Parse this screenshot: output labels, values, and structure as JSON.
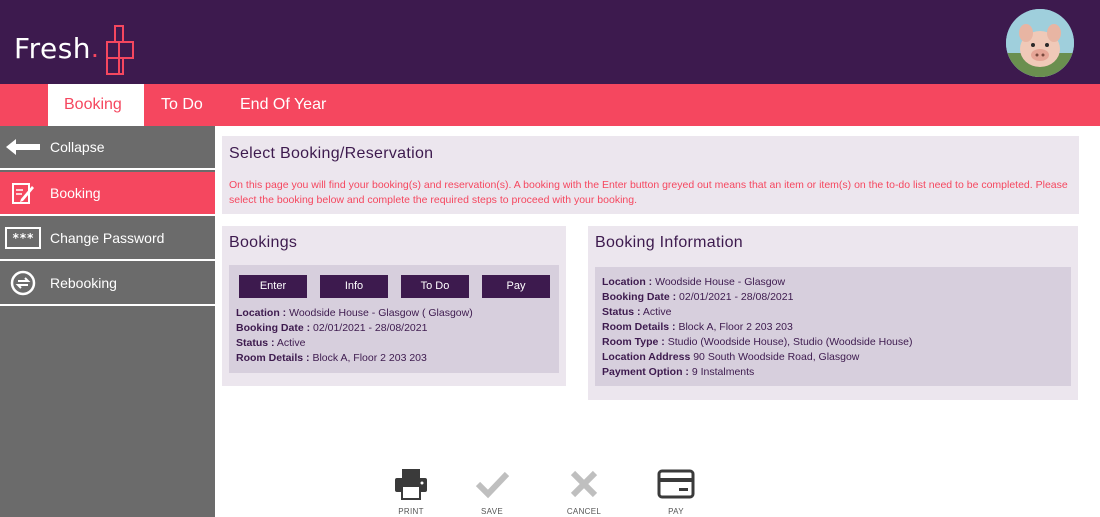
{
  "brand": {
    "name": "Fresh",
    "dot": ".",
    "accent": "#f5475f",
    "primary": "#3d1a4e"
  },
  "tabs": [
    {
      "label": "Booking",
      "active": true
    },
    {
      "label": "To Do",
      "active": false
    },
    {
      "label": "End Of Year",
      "active": false
    }
  ],
  "sidebar": {
    "items": [
      {
        "label": "Collapse",
        "icon": "arrow-left-icon",
        "active": false
      },
      {
        "label": "Booking",
        "icon": "edit-icon",
        "active": true
      },
      {
        "label": "Change Password",
        "icon": "password-icon",
        "active": false
      },
      {
        "label": "Rebooking",
        "icon": "rebooking-icon",
        "active": false
      }
    ]
  },
  "select_panel": {
    "title": "Select Booking/Reservation",
    "description": "On this page you will find your booking(s) and reservation(s). A booking with the Enter button greyed out means that an item or item(s) on the to-do list need to be completed. Please select the booking below and complete the required steps to proceed with your booking."
  },
  "bookings": {
    "title": "Bookings",
    "buttons": [
      "Enter",
      "Info",
      "To Do",
      "Pay"
    ],
    "details": [
      {
        "label": "Location :",
        "value": "Woodside House - Glasgow ( Glasgow)"
      },
      {
        "label": "Booking Date :",
        "value": "02/01/2021 - 28/08/2021"
      },
      {
        "label": "Status :",
        "value": "Active"
      },
      {
        "label": "Room Details :",
        "value": "Block A, Floor 2 203 203"
      }
    ]
  },
  "booking_info": {
    "title": "Booking Information",
    "details": [
      {
        "label": "Location :",
        "value": "Woodside House - Glasgow"
      },
      {
        "label": "Booking Date :",
        "value": "02/01/2021 - 28/08/2021"
      },
      {
        "label": "Status :",
        "value": "Active"
      },
      {
        "label": "Room Details :",
        "value": "Block A, Floor 2 203 203"
      },
      {
        "label": "Room Type :",
        "value": "Studio (Woodside House), Studio (Woodside House)"
      },
      {
        "label": "Location Address",
        "value": "90 South Woodside Road, Glasgow"
      },
      {
        "label": "Payment Option :",
        "value": "9 Instalments"
      }
    ]
  },
  "toolbar": {
    "print": "PRINT",
    "save": "SAVE",
    "cancel": "CANCEL",
    "pay": "PAY"
  }
}
